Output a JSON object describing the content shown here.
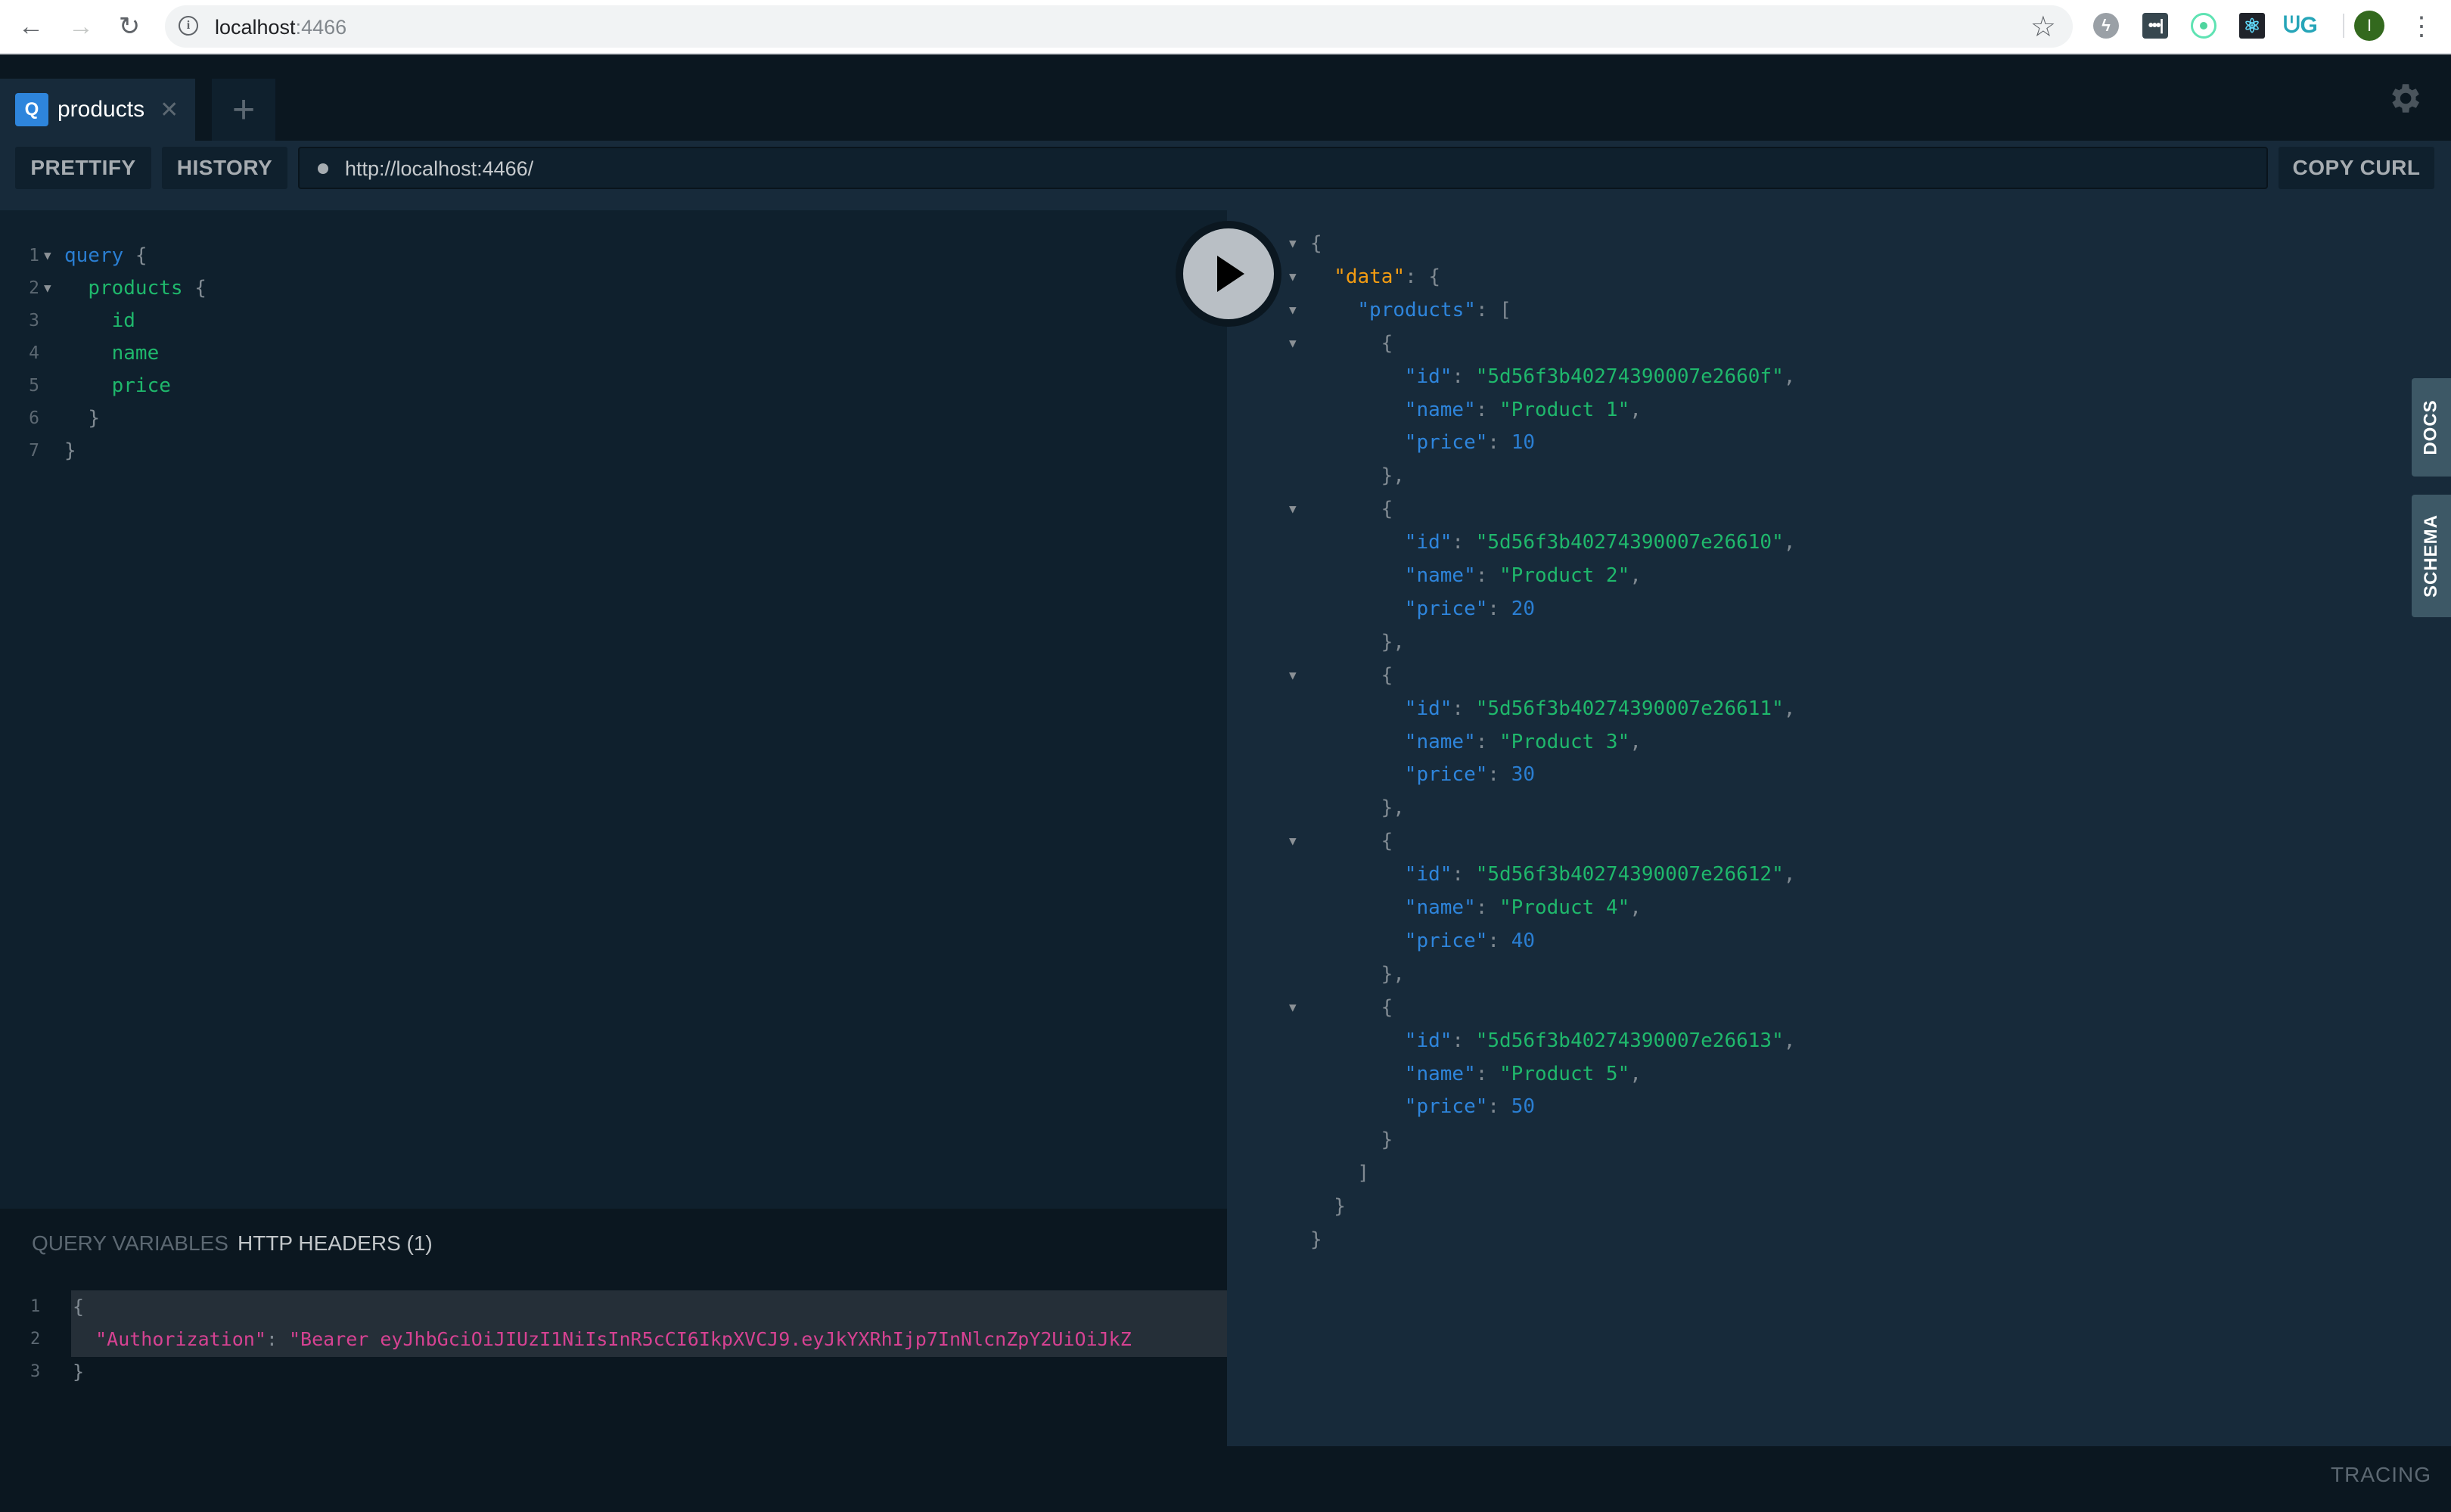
{
  "browser": {
    "url_host": "localhost",
    "url_port": ":4466",
    "back_icon": "arrow-left-icon",
    "forward_icon": "arrow-right-icon",
    "reload_icon": "reload-icon",
    "info_icon": "info-icon",
    "bookmark_icon": "star-icon",
    "extensions": [
      "lightning-icon",
      "password-manager-icon",
      "orbit-icon",
      "react-devtools-icon",
      "g-extension-icon"
    ],
    "profile_initial": "I",
    "menu_icon": "kebab-menu-icon"
  },
  "tabs": [
    {
      "badge": "Q",
      "label": "products",
      "close": "✕"
    }
  ],
  "new_tab_label": "+",
  "toolbar": {
    "prettify": "PRETTIFY",
    "history": "HISTORY",
    "endpoint": "http://localhost:4466/",
    "copy_curl": "COPY CURL"
  },
  "query_editor": {
    "lines": [
      {
        "num": "1",
        "fold": true,
        "indent": "",
        "tokens": [
          [
            "kw",
            "query"
          ],
          [
            "punct",
            " {"
          ]
        ]
      },
      {
        "num": "2",
        "fold": true,
        "indent": "  ",
        "tokens": [
          [
            "field",
            "products"
          ],
          [
            "punct",
            " {"
          ]
        ]
      },
      {
        "num": "3",
        "fold": false,
        "indent": "    ",
        "tokens": [
          [
            "field",
            "id"
          ]
        ]
      },
      {
        "num": "4",
        "fold": false,
        "indent": "    ",
        "tokens": [
          [
            "field",
            "name"
          ]
        ]
      },
      {
        "num": "5",
        "fold": false,
        "indent": "    ",
        "tokens": [
          [
            "field",
            "price"
          ]
        ]
      },
      {
        "num": "6",
        "fold": false,
        "indent": "  ",
        "tokens": [
          [
            "punct",
            "}"
          ]
        ]
      },
      {
        "num": "7",
        "fold": false,
        "indent": "",
        "tokens": [
          [
            "punct",
            "}"
          ]
        ]
      }
    ]
  },
  "bottom_pane": {
    "tabs": [
      "QUERY VARIABLES",
      "HTTP HEADERS (1)"
    ],
    "active_tab": "HTTP HEADERS (1)",
    "headers_lines": [
      {
        "num": "1",
        "tokens": [
          [
            "punct",
            "{"
          ]
        ]
      },
      {
        "num": "2",
        "tokens": [
          [
            "str-pink",
            "  \"Authorization\""
          ],
          [
            "punct",
            ": "
          ],
          [
            "str-pink",
            "\"Bearer eyJhbGciOiJIUzI1NiIsInR5cCI6IkpXVCJ9.eyJkYXRhIjp7InNlcnZpY2UiOiJkZ"
          ]
        ]
      },
      {
        "num": "3",
        "tokens": [
          [
            "punct",
            "}"
          ]
        ]
      }
    ]
  },
  "result": {
    "products": [
      {
        "id": "5d56f3b40274390007e2660f",
        "name": "Product 1",
        "price": 10
      },
      {
        "id": "5d56f3b40274390007e26610",
        "name": "Product 2",
        "price": 20
      },
      {
        "id": "5d56f3b40274390007e26611",
        "name": "Product 3",
        "price": 30
      },
      {
        "id": "5d56f3b40274390007e26612",
        "name": "Product 4",
        "price": 40
      },
      {
        "id": "5d56f3b40274390007e26613",
        "name": "Product 5",
        "price": 50
      }
    ]
  },
  "side_tabs": [
    "DOCS",
    "SCHEMA"
  ],
  "footer": {
    "tracing": "TRACING"
  },
  "colors": {
    "accent": "#2e85dc",
    "json_key_root": "#f39c12",
    "json_key": "#2e85dc",
    "json_string": "#1fb86c",
    "json_number": "#2a7ed2",
    "header_string": "#d64292"
  }
}
